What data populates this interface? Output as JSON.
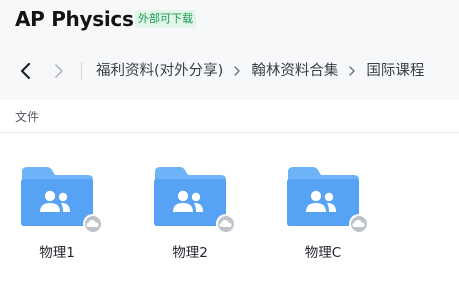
{
  "header": {
    "title": "AP Physics",
    "badge": "外部可下载"
  },
  "breadcrumb": {
    "items": [
      "福利资料(对外分享)",
      "翰林资料合集",
      "国际课程"
    ]
  },
  "section": {
    "label": "文件"
  },
  "files": [
    {
      "name": "物理1",
      "icon": "shared-folder-icon"
    },
    {
      "name": "物理2",
      "icon": "shared-folder-icon"
    },
    {
      "name": "物理C",
      "icon": "shared-folder-icon"
    }
  ],
  "colors": {
    "folder_back": "#6cb3f7",
    "folder_front": "#56a2f5",
    "badge_text": "#1a9b4f",
    "badge_bg": "#e1f5e8",
    "header_bg": "#f7f8fa"
  }
}
